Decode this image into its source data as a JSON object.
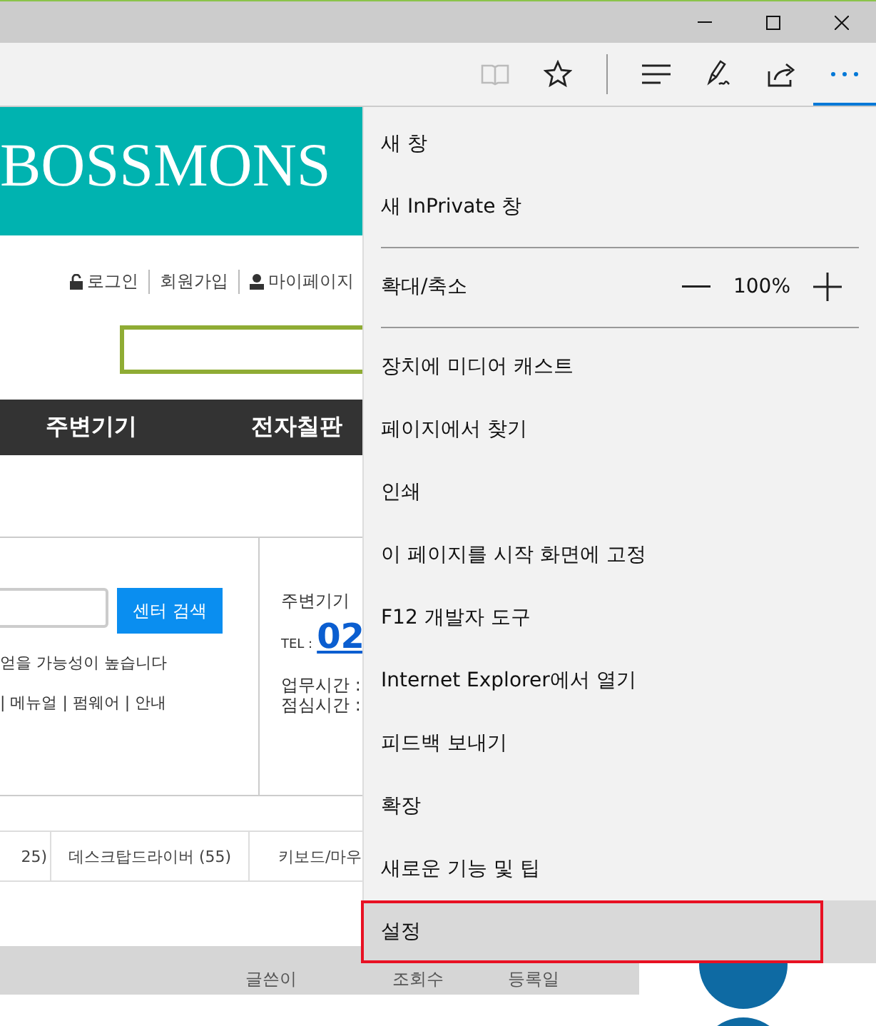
{
  "toolbar": {
    "buttons": [
      {
        "kind": "reading",
        "disabled": true,
        "selected": false
      },
      {
        "kind": "star",
        "disabled": false,
        "selected": false
      },
      {
        "kind": "divider"
      },
      {
        "kind": "hub",
        "disabled": false,
        "selected": false
      },
      {
        "kind": "notes",
        "disabled": false,
        "selected": false
      },
      {
        "kind": "share",
        "disabled": false,
        "selected": false
      },
      {
        "kind": "more",
        "disabled": false,
        "selected": true
      }
    ]
  },
  "page": {
    "logo": "BOSSMONS",
    "top_links": [
      {
        "kind": "lock",
        "label": "로그인"
      },
      {
        "kind": "plain",
        "label": "회원가입"
      },
      {
        "kind": "person",
        "label": "마이페이지"
      }
    ],
    "nav": [
      "주변기기",
      "전자칠판"
    ],
    "center_search": {
      "button": "센터 검색",
      "hint": "얻을 가능성이 높습니다",
      "links": "| 메뉴얼 | 펌웨어 | 안내"
    },
    "contact": {
      "title": "주변기기",
      "tel_label": "TEL :",
      "tel": "02",
      "hours": [
        "업무시간 :",
        "점심시간 :"
      ]
    },
    "categories": [
      "25)",
      "데스크탑드라이버 (55)",
      "키보드/마우"
    ],
    "table": {
      "columns": [
        "글쓴이",
        "조회수",
        "등록일"
      ]
    }
  },
  "menu": {
    "items": [
      {
        "kind": "item",
        "label": "새 창",
        "selected": false
      },
      {
        "kind": "item",
        "label": "새 InPrivate 창",
        "selected": false
      },
      {
        "kind": "separator"
      },
      {
        "kind": "zoom",
        "label": "확대/축소",
        "value": "100%"
      },
      {
        "kind": "separator"
      },
      {
        "kind": "item",
        "label": "장치에 미디어 캐스트",
        "selected": false
      },
      {
        "kind": "item",
        "label": "페이지에서 찾기",
        "selected": false
      },
      {
        "kind": "item",
        "label": "인쇄",
        "selected": false
      },
      {
        "kind": "item",
        "label": "이 페이지를 시작 화면에 고정",
        "selected": false
      },
      {
        "kind": "item",
        "label": "F12 개발자 도구",
        "selected": false
      },
      {
        "kind": "item",
        "label": "Internet Explorer에서 열기",
        "selected": false
      },
      {
        "kind": "item",
        "label": "피드백 보내기",
        "selected": false
      },
      {
        "kind": "item",
        "label": "확장",
        "selected": false
      },
      {
        "kind": "item",
        "label": "새로운 기능 및 팁",
        "selected": false
      },
      {
        "kind": "item",
        "label": "설정",
        "selected": true
      }
    ]
  }
}
